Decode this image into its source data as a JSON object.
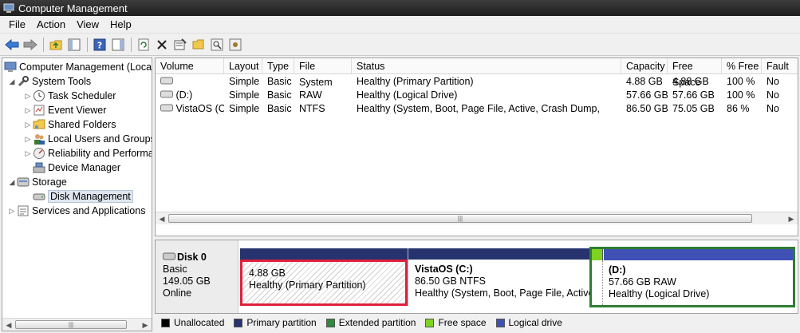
{
  "window": {
    "title": "Computer Management"
  },
  "menu": [
    "File",
    "Action",
    "View",
    "Help"
  ],
  "toolbar": [
    "back-icon",
    "forward-icon",
    "up-folder-icon",
    "show-tree-icon",
    "help-icon",
    "properties-pane-icon",
    "refresh-icon",
    "delete-icon",
    "properties-icon",
    "open-icon",
    "find-icon",
    "settings-icon"
  ],
  "tree": {
    "root": "Computer Management (Local",
    "system_tools": "System Tools",
    "task_scheduler": "Task Scheduler",
    "event_viewer": "Event Viewer",
    "shared_folders": "Shared Folders",
    "local_users": "Local Users and Groups",
    "reliability": "Reliability and Performa",
    "device_manager": "Device Manager",
    "storage": "Storage",
    "disk_management": "Disk Management",
    "services": "Services and Applications"
  },
  "volume_table": {
    "headers": [
      "Volume",
      "Layout",
      "Type",
      "File System",
      "Status",
      "Capacity",
      "Free Space",
      "% Free",
      "Fault"
    ],
    "rows": [
      [
        "",
        "Simple",
        "Basic",
        "",
        "Healthy (Primary Partition)",
        "4.88 GB",
        "4.88 GB",
        "100 %",
        "No"
      ],
      [
        "(D:)",
        "Simple",
        "Basic",
        "RAW",
        "Healthy (Logical Drive)",
        "57.66 GB",
        "57.66 GB",
        "100 %",
        "No"
      ],
      [
        "VistaOS (C:)",
        "Simple",
        "Basic",
        "NTFS",
        "Healthy (System, Boot, Page File, Active, Crash Dump,",
        "86.50 GB",
        "75.05 GB",
        "86 %",
        "No"
      ]
    ]
  },
  "disk": {
    "name": "Disk 0",
    "type": "Basic",
    "size": "149.05 GB",
    "status": "Online",
    "partitions": [
      {
        "name": "",
        "size": "4.88 GB",
        "status": "Healthy (Primary Partition)"
      },
      {
        "name": "VistaOS  (C:)",
        "size": "86.50 GB NTFS",
        "status": "Healthy (System, Boot, Page File, Active,"
      },
      {
        "name": "(D:)",
        "size": "57.66 GB RAW",
        "status": "Healthy (Logical Drive)"
      }
    ]
  },
  "legend": [
    {
      "label": "Unallocated",
      "color": "#000000"
    },
    {
      "label": "Primary partition",
      "color": "#26336e"
    },
    {
      "label": "Extended partition",
      "color": "#2e8b3a"
    },
    {
      "label": "Free space",
      "color": "#7ed321"
    },
    {
      "label": "Logical drive",
      "color": "#3f51b5"
    }
  ],
  "colors": {
    "highlight_red": "#e0203c",
    "highlight_green": "#2e7d32",
    "primary_bar": "#26336e",
    "logical_bar": "#3f51b5",
    "free_bar": "#7ed321"
  }
}
